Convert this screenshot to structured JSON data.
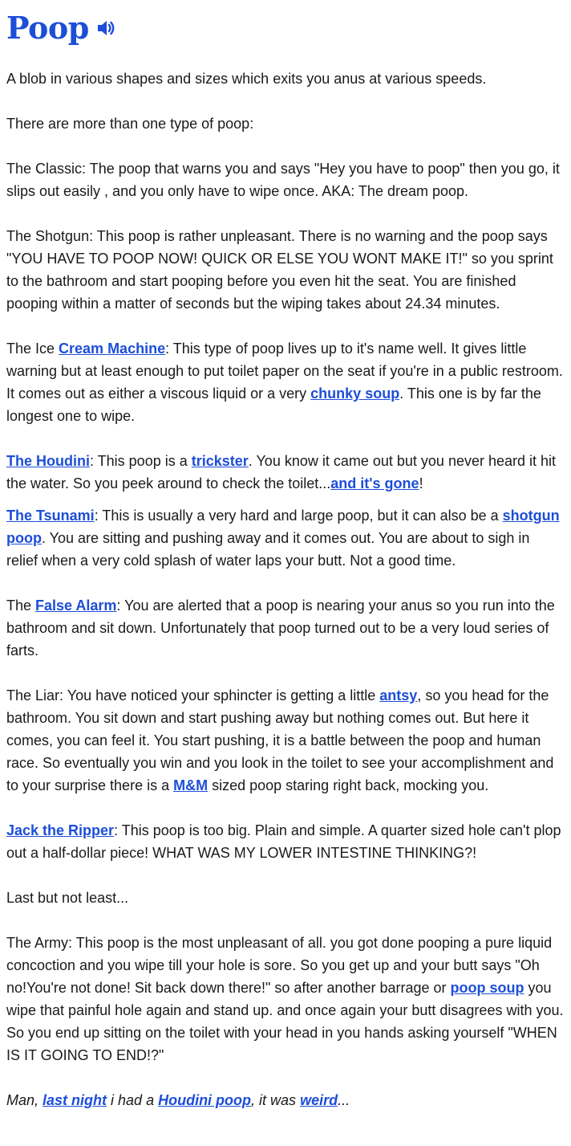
{
  "entry": {
    "word": "Poop",
    "speaker_icon": "speaker-icon"
  },
  "definition": {
    "p1": "A blob in various shapes and sizes which exits you anus at various speeds.",
    "p2": "There are more than one type of poop:",
    "p3": "The Classic: The poop that warns you and says \"Hey you have to poop\" then you go, it slips out easily , and you only have to wipe once. AKA: The dream poop.",
    "p4": "The Shotgun: This poop is rather unpleasant. There is no warning and the poop says \"YOU HAVE TO POOP NOW! QUICK OR ELSE YOU WONT MAKE IT!\" so you sprint to the bathroom and start pooping before you even hit the seat. You are finished pooping within a matter of seconds but the wiping takes about 24.34 minutes.",
    "p5": {
      "t1": "The Ice ",
      "l1": "Cream Machine",
      "t2": ": This type of poop lives up to it's name well. It gives little warning but at least enough to put toilet paper on the seat if you're in a public restroom. It comes out as either a viscous liquid or a very ",
      "l2": "chunky soup",
      "t3": ". This one is by far the longest one to wipe."
    },
    "p6": {
      "l1": "The Houdini",
      "t1": ": This poop is a ",
      "l2": "trickster",
      "t2": ". You know it came out but you never heard it hit the water. So you peek around to check the toilet...",
      "l3": "and it's gone",
      "t3": "!"
    },
    "p7": {
      "l1": "The Tsunami",
      "t1": ": This is usually a very hard and large poop, but it can also be a ",
      "l2": "shotgun poop",
      "t2": ". You are sitting and pushing away and it comes out. You are about to sigh in relief when a very cold splash of water laps your butt. Not a good time."
    },
    "p8": {
      "t1": "The ",
      "l1": "False Alarm",
      "t2": ": You are alerted that a poop is nearing your anus so you run into the bathroom and sit down. Unfortunately that poop turned out to be a very loud series of farts."
    },
    "p9": {
      "t1": "The Liar: You have noticed your sphincter is getting a little ",
      "l1": "antsy",
      "t2": ", so you head for the bathroom. You sit down and start pushing away but nothing comes out. But here it comes, you can feel it. You start pushing, it is a battle between the poop and human race. So eventually you win and you look in the toilet to see your accomplishment and to your surprise there is a ",
      "l2": "M&M",
      "t3": " sized poop staring right back, mocking you."
    },
    "p10": {
      "l1": "Jack the Ripper",
      "t1": ": This poop is too big. Plain and simple. A quarter sized hole can't plop out a half-dollar piece! WHAT WAS MY LOWER INTESTINE THINKING?!"
    },
    "p11": "Last but not least...",
    "p12": {
      "t1": "The Army: This poop is the most unpleasant of all. you got done pooping a pure liquid concoction and you wipe till your hole is sore. So you get up and your butt says \"Oh no!You're not done! Sit back down there!\" so after another barrage or ",
      "l1": "poop soup",
      "t2": " you wipe that painful hole again and stand up. and once again your butt disagrees with you. So you end up sitting on the toilet with your head in you hands asking yourself \"WHEN IS IT GOING TO END!?\""
    }
  },
  "example": {
    "t1": "Man, ",
    "l1": "last night",
    "t2": " i had a ",
    "l2": "Houdini poop",
    "t3": ", it was ",
    "l3": "weird",
    "t4": "..."
  },
  "colors": {
    "link": "#1d4ed8",
    "title": "#1d4ed8",
    "text": "#1a1a1a"
  }
}
